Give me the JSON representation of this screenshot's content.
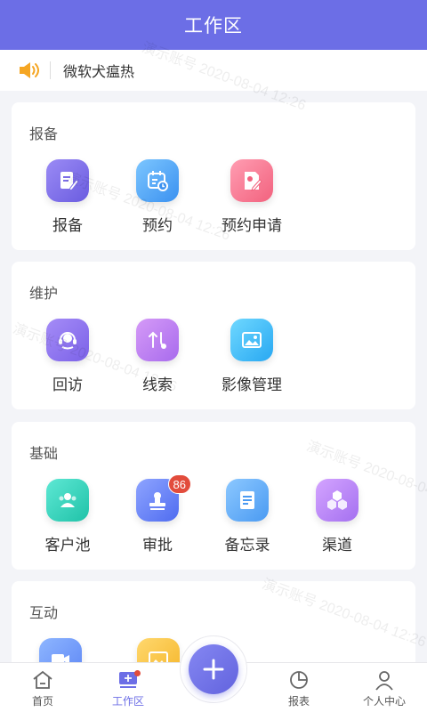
{
  "header": {
    "title": "工作区"
  },
  "notice": {
    "text": "微软犬瘟热",
    "icon": "speaker-icon"
  },
  "watermark": {
    "name": "演示账号",
    "time": "2020-08-04 12:26"
  },
  "sections": [
    {
      "title": "报备",
      "items": [
        {
          "label": "报备",
          "icon": "edit-doc-icon"
        },
        {
          "label": "预约",
          "icon": "calendar-icon"
        },
        {
          "label": "预约申请",
          "icon": "apply-icon"
        }
      ]
    },
    {
      "title": "维护",
      "items": [
        {
          "label": "回访",
          "icon": "headset-icon"
        },
        {
          "label": "线索",
          "icon": "clue-icon"
        },
        {
          "label": "影像管理",
          "icon": "image-icon"
        }
      ]
    },
    {
      "title": "基础",
      "items": [
        {
          "label": "客户池",
          "icon": "customers-icon"
        },
        {
          "label": "审批",
          "icon": "approve-icon",
          "badge": "86"
        },
        {
          "label": "备忘录",
          "icon": "memo-icon"
        },
        {
          "label": "渠道",
          "icon": "channel-icon"
        }
      ]
    },
    {
      "title": "互动",
      "items": [
        {
          "icon": "video-icon"
        },
        {
          "icon": "picture-icon"
        }
      ]
    }
  ],
  "tabbar": {
    "tabs": [
      {
        "label": "首页",
        "icon": "home-icon"
      },
      {
        "label": "工作区",
        "icon": "workspace-icon",
        "active": true
      },
      {
        "label": "报表",
        "icon": "pie-chart-icon"
      },
      {
        "label": "个人中心",
        "icon": "user-icon"
      }
    ],
    "fab_icon": "plus-icon"
  },
  "colors": {
    "primary": "#6c6ee6",
    "badge": "#e24c3c",
    "background": "#f3f4f8"
  }
}
